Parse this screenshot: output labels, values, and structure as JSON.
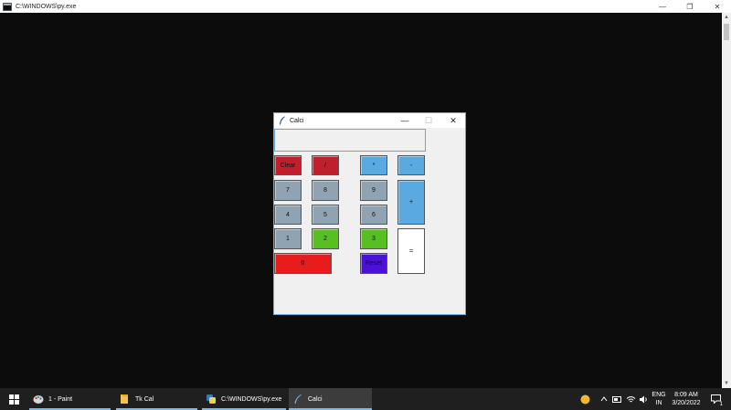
{
  "console": {
    "title": "C:\\WINDOWS\\py.exe",
    "controls": {
      "minimize": "—",
      "maximize": "❐",
      "close": "✕"
    }
  },
  "calc": {
    "title": "Calci",
    "controls": {
      "minimize": "—",
      "maximize": "☐",
      "close": "✕"
    },
    "display_value": "",
    "keys": [
      {
        "name": "clear-button",
        "label": "Clear",
        "color": "#c0202c"
      },
      {
        "name": "divide-button",
        "label": "/",
        "color": "#c0202c"
      },
      {
        "name": "multiply-button",
        "label": "*",
        "color": "#5aa9e0"
      },
      {
        "name": "minus-button",
        "label": "-",
        "color": "#5aa9e0"
      },
      {
        "name": "seven-button",
        "label": "7",
        "color": "#8fa3b3"
      },
      {
        "name": "eight-button",
        "label": "8",
        "color": "#8fa3b3"
      },
      {
        "name": "nine-button",
        "label": "9",
        "color": "#8fa3b3"
      },
      {
        "name": "plus-button",
        "label": "+",
        "color": "#5aa9e0"
      },
      {
        "name": "four-button",
        "label": "4",
        "color": "#8fa3b3"
      },
      {
        "name": "five-button",
        "label": "5",
        "color": "#8fa3b3"
      },
      {
        "name": "six-button",
        "label": "6",
        "color": "#8fa3b3"
      },
      {
        "name": "one-button",
        "label": "1",
        "color": "#8fa3b3"
      },
      {
        "name": "two-button",
        "label": "2",
        "color": "#56c021"
      },
      {
        "name": "three-button",
        "label": "3",
        "color": "#56c021"
      },
      {
        "name": "equals-button",
        "label": "=",
        "color": "#ffffff"
      },
      {
        "name": "zero-button",
        "label": "0",
        "color": "#e81c1c"
      },
      {
        "name": "reset-button",
        "label": "Reset",
        "color": "#4a12d6"
      }
    ]
  },
  "taskbar": {
    "items": [
      {
        "label": "1 - Paint",
        "icon": "paint-icon"
      },
      {
        "label": "Tk Cal",
        "icon": "folder-icon"
      },
      {
        "label": "C:\\WINDOWS\\py.exe",
        "icon": "python-icon"
      },
      {
        "label": "Calci",
        "icon": "feather-icon"
      }
    ],
    "tray": {
      "language": "ENG",
      "region": "IN",
      "time": "8:09 AM",
      "date": "3/20/2022",
      "notification_count": "1"
    }
  },
  "colors": {
    "console_bg": "#0c0c0c",
    "taskbar_bg": "#1f1f1f",
    "accent": "#76b9ed"
  }
}
